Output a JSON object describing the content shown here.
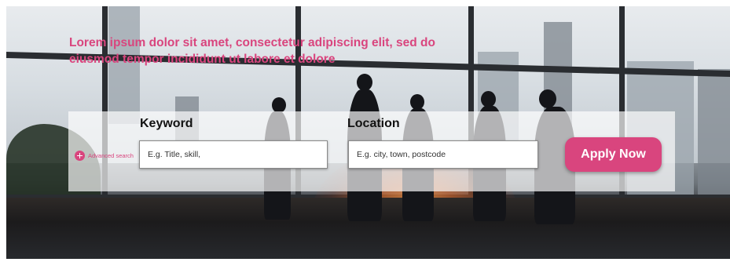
{
  "hero": {
    "headline": "Lorem ipsum dolor sit amet, consectetur adipiscing elit, sed do eiusmod tempor incididunt ut labore et dolore"
  },
  "search": {
    "advanced_label": "Advanced search",
    "keyword": {
      "label": "Keyword",
      "placeholder": "E.g. Title, skill,"
    },
    "location": {
      "label": "Location",
      "placeholder": "E.g. city, town, postcode"
    },
    "apply_label": "Apply Now"
  },
  "colors": {
    "accent": "#d9457e"
  },
  "icons": {
    "advanced": "plus-circle-icon"
  }
}
